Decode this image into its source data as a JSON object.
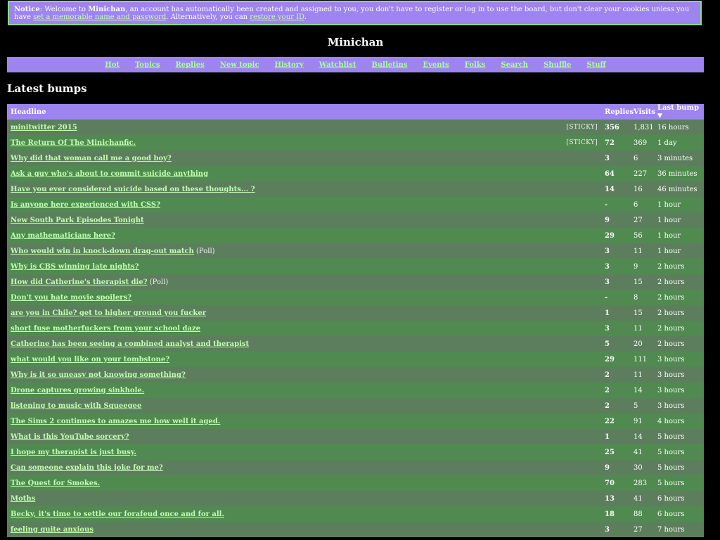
{
  "notice": {
    "label": "Notice",
    "text1": ": Welcome to ",
    "site": "Minichan",
    "text2": ", an account has automatically been created and assigned to you, you don't have to register or log in to use the board, but don't clear your cookies unless you have ",
    "link1": "set a memorable name and password",
    "text3": ". Alternatively, you can ",
    "link2": "restore your ID",
    "text4": "."
  },
  "site_title": "Minichan",
  "nav": [
    "Hot",
    "Topics",
    "Replies",
    "New topic",
    "History",
    "Watchlist",
    "Bulletins",
    "Events",
    "Folks",
    "Search",
    "Shuffle",
    "Stuff"
  ],
  "section_title": "Latest bumps",
  "table": {
    "headers": {
      "headline": "Headline",
      "replies": "Replies",
      "visits": "Visits",
      "last_bump": "Last bump",
      "sort_arrow": "▼"
    },
    "rows": [
      {
        "headline": "minitwitter 2015",
        "tag": "[STICKY]",
        "replies": "356",
        "visits": "1,831",
        "last": "16 hours"
      },
      {
        "headline": "The Return Of The Minichanfic.",
        "tag": "[STICKY]",
        "replies": "72",
        "visits": "369",
        "last": "1 day"
      },
      {
        "headline": "Why did that woman call me a good boy?",
        "replies": "3",
        "visits": "6",
        "last": "3 minutes"
      },
      {
        "headline": "Ask a guy who's about to commit suicide anything",
        "replies": "64",
        "visits": "227",
        "last": "36 minutes"
      },
      {
        "headline": "Have you ever considered suicide based on these thoughts... ?",
        "replies": "14",
        "visits": "16",
        "last": "46 minutes"
      },
      {
        "headline": "Is anyone here experienced with CSS?",
        "replies": "-",
        "visits": "6",
        "last": "1 hour"
      },
      {
        "headline": "New South Park Episodes Tonight",
        "replies": "9",
        "visits": "27",
        "last": "1 hour"
      },
      {
        "headline": "Any mathematicians here?",
        "replies": "29",
        "visits": "56",
        "last": "1 hour"
      },
      {
        "headline": "Who would win in knock-down drag-out match",
        "poll": "(Poll)",
        "replies": "3",
        "visits": "11",
        "last": "1 hour"
      },
      {
        "headline": "Why is CBS winning late nights?",
        "replies": "3",
        "visits": "9",
        "last": "2 hours"
      },
      {
        "headline": "How did Catherine's therapist die?",
        "poll": "(Poll)",
        "replies": "3",
        "visits": "15",
        "last": "2 hours"
      },
      {
        "headline": "Don't you hate movie spoilers?",
        "replies": "-",
        "visits": "8",
        "last": "2 hours"
      },
      {
        "headline": "are you in Chile? get to higher ground you fucker",
        "replies": "1",
        "visits": "15",
        "last": "2 hours"
      },
      {
        "headline": "short fuse motherfuckers from your school daze",
        "replies": "3",
        "visits": "11",
        "last": "2 hours"
      },
      {
        "headline": "Catherine has been seeing a combined analyst and therapist",
        "replies": "5",
        "visits": "20",
        "last": "2 hours"
      },
      {
        "headline": "what would you like on your tombstone?",
        "replies": "29",
        "visits": "111",
        "last": "3 hours"
      },
      {
        "headline": "Why is it so uneasy not knowing something?",
        "replies": "2",
        "visits": "11",
        "last": "3 hours"
      },
      {
        "headline": "Drone captures growing sinkhole.",
        "replies": "2",
        "visits": "14",
        "last": "3 hours"
      },
      {
        "headline": "listening to music with Squeegee",
        "replies": "2",
        "visits": "5",
        "last": "3 hours"
      },
      {
        "headline": "The Sims 2 continues to amazes me how well it aged.",
        "replies": "22",
        "visits": "91",
        "last": "4 hours"
      },
      {
        "headline": "What is this YouTube sorcery?",
        "replies": "1",
        "visits": "14",
        "last": "5 hours"
      },
      {
        "headline": "I hope my therapist is just busy.",
        "replies": "25",
        "visits": "41",
        "last": "5 hours"
      },
      {
        "headline": "Can someone explain this joke for me?",
        "replies": "9",
        "visits": "30",
        "last": "5 hours"
      },
      {
        "headline": "The Quest for Smokes.",
        "replies": "70",
        "visits": "283",
        "last": "5 hours"
      },
      {
        "headline": "Moths",
        "replies": "13",
        "visits": "41",
        "last": "6 hours"
      },
      {
        "headline": "Becky, it's time to settle our forafeud once and for all.",
        "replies": "18",
        "visits": "88",
        "last": "6 hours"
      },
      {
        "headline": "feeling quite anxious",
        "replies": "3",
        "visits": "27",
        "last": "7 hours"
      }
    ]
  },
  "colors": {
    "accent": "#9d84ee",
    "row_odd": "#5d7e5d",
    "row_even": "#508a50",
    "link": "#c0ffb0"
  }
}
